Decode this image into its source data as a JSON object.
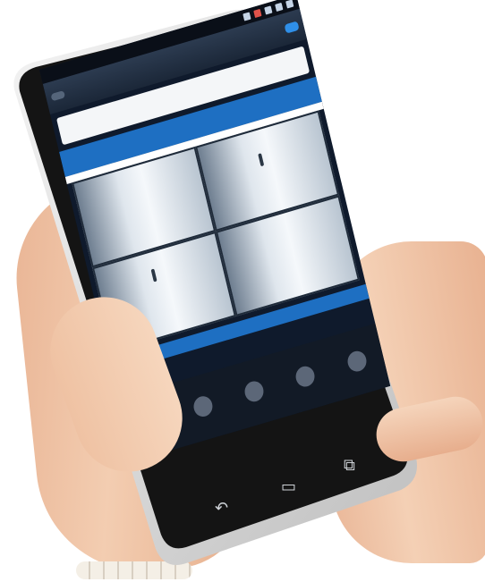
{
  "app": {
    "title": "",
    "back_label": "",
    "save_label": ""
  },
  "screen": {
    "selector_text": "",
    "banner_text": "",
    "param_lines": [
      "",
      ""
    ],
    "hint_text": ""
  },
  "tabs": [
    {
      "icon": "grid-icon",
      "label": "",
      "active": true
    },
    {
      "icon": "handle-icon",
      "label": "",
      "active": false
    },
    {
      "icon": "gear-icon",
      "label": "",
      "active": false
    },
    {
      "icon": "hinge-icon",
      "label": "",
      "active": false
    },
    {
      "icon": "settings-icon",
      "label": "",
      "active": false
    }
  ],
  "nav_buttons": [
    "back-icon",
    "home-icon",
    "recent-icon"
  ],
  "colors": {
    "accent": "#1e6fc2",
    "phone_body": "#1a1a1a",
    "phone_trim": "#e9e9e9",
    "skin": "#f0c6a8"
  }
}
